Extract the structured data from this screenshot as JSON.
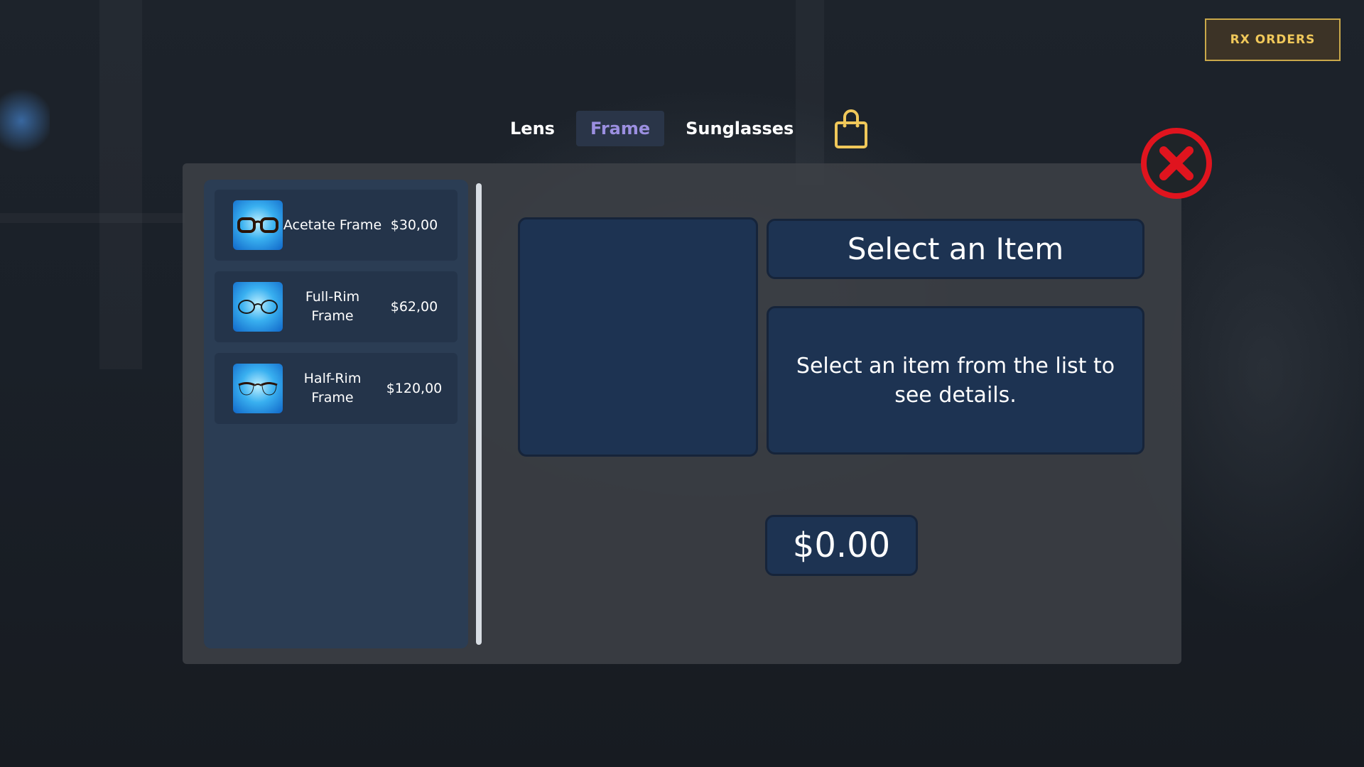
{
  "header": {
    "rx_orders_label": "RX ORDERS"
  },
  "tabs": [
    {
      "label": "Lens",
      "active": false
    },
    {
      "label": "Frame",
      "active": true
    },
    {
      "label": "Sunglasses",
      "active": false
    }
  ],
  "icons": {
    "cart": "shopping-bag-icon",
    "close": "close-icon"
  },
  "colors": {
    "accent_gold": "#f0c85a",
    "active_tab_text": "#9b8fe0",
    "close_red": "#e0141e",
    "panel_blue": "#1d3352"
  },
  "items": [
    {
      "name": "Acetate Frame",
      "price": "$30,00",
      "icon": "acetate-glasses-icon"
    },
    {
      "name": "Full-Rim Frame",
      "price": "$62,00",
      "icon": "full-rim-glasses-icon"
    },
    {
      "name": "Half-Rim Frame",
      "price": "$120,00",
      "icon": "half-rim-glasses-icon"
    }
  ],
  "details": {
    "title": "Select an Item",
    "description": "Select an item from the list to see details.",
    "price": "$0.00"
  }
}
